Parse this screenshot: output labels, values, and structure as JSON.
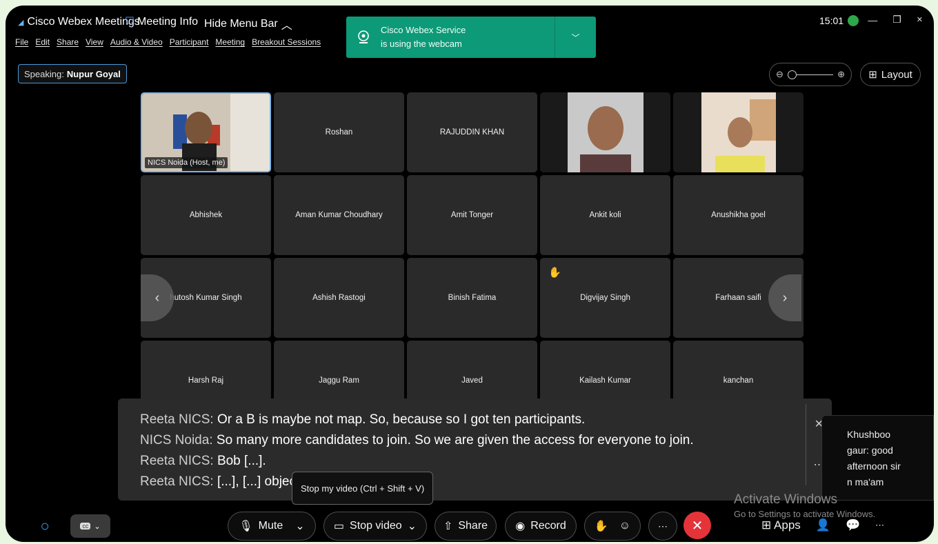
{
  "titlebar": {
    "app_name": "Cisco Webex Meetings",
    "meeting_info": "Meeting Info",
    "hide_menu": "Hide Menu Bar",
    "time": "15:01"
  },
  "menu": [
    "File",
    "Edit",
    "Share",
    "View",
    "Audio & Video",
    "Participant",
    "Meeting",
    "Breakout Sessions"
  ],
  "notification": {
    "line1": "Cisco Webex Service",
    "line2": "is using the webcam"
  },
  "speaking": {
    "label": "Speaking:",
    "name": "Nupur Goyal"
  },
  "layout_label": "Layout",
  "tiles": [
    {
      "name": "NICS Noida (Host, me)",
      "type": "self"
    },
    {
      "name": "Roshan",
      "type": "name"
    },
    {
      "name": "RAJUDDIN KHAN",
      "type": "name"
    },
    {
      "name": "",
      "type": "video-male"
    },
    {
      "name": "",
      "type": "video-female"
    },
    {
      "name": "Abhishek",
      "type": "name"
    },
    {
      "name": "Aman Kumar Choudhary",
      "type": "name"
    },
    {
      "name": "Amit Tonger",
      "type": "name"
    },
    {
      "name": "Ankit koli",
      "type": "name"
    },
    {
      "name": "Anushikha goel",
      "type": "name"
    },
    {
      "name": "hutosh Kumar Singh",
      "type": "name"
    },
    {
      "name": "Ashish Rastogi",
      "type": "name"
    },
    {
      "name": "Binish Fatima",
      "type": "name"
    },
    {
      "name": "Digvijay Singh",
      "type": "raised"
    },
    {
      "name": "Farhaan saifi",
      "type": "name"
    },
    {
      "name": "Harsh Raj",
      "type": "name"
    },
    {
      "name": "Jaggu Ram",
      "type": "name"
    },
    {
      "name": "Javed",
      "type": "name"
    },
    {
      "name": "Kailash Kumar",
      "type": "name"
    },
    {
      "name": "kanchan",
      "type": "name"
    }
  ],
  "captions": [
    {
      "speaker": "Reeta NICS:",
      "text": "Or a B is maybe not map. So, because so I got ten participants."
    },
    {
      "speaker": "NICS Noida:",
      "text": "So many more candidates to join. So we are given the access for everyone to join."
    },
    {
      "speaker": "Reeta NICS:",
      "text": "Bob [...]."
    },
    {
      "speaker": "Reeta NICS:",
      "text": "[...], [...] objecti"
    }
  ],
  "tooltip": "Stop my video (Ctrl + Shift + V)",
  "chat_popup": [
    "Khushboo",
    "gaur: good",
    "afternoon sir",
    "n ma'am"
  ],
  "activate_windows": {
    "title": "Activate Windows",
    "subtitle": "Go to Settings to activate Windows."
  },
  "toolbar": {
    "mute": "Mute",
    "stop_video": "Stop video",
    "share": "Share",
    "record": "Record",
    "apps": "Apps"
  },
  "colors": {
    "notification": "#0d9a78",
    "end_call": "#e4343a",
    "self_border": "#7bb7ec"
  }
}
